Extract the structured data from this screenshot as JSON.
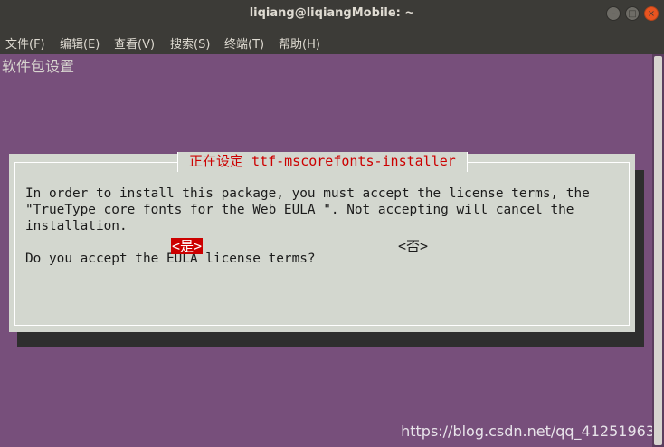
{
  "window": {
    "title": "liqiang@liqiangMobile: ~"
  },
  "menu": {
    "items": [
      "文件(F)",
      "编辑(E)",
      "查看(V)",
      "搜索(S)",
      "终端(T)",
      "帮助(H)"
    ]
  },
  "terminal": {
    "backtitle": "软件包设置"
  },
  "dialog": {
    "title": "正在设定 ttf-mscorefonts-installer",
    "lines": [
      "In order to install this package, you must accept the license terms, the",
      "\"TrueType core fonts for the Web EULA \". Not accepting will cancel the",
      "installation.",
      "Do you accept the EULA license terms?"
    ],
    "yes_label": "<是>",
    "no_label": "<否>"
  },
  "watermark": "https://blog.csdn.net/qq_41251963"
}
